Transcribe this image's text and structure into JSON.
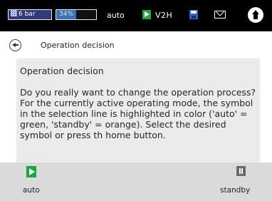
{
  "status_bar": {
    "pressure": "6 bar",
    "soc": "34%",
    "soc_fill_fraction": 0.5,
    "mode": "auto",
    "v2h": "V2H",
    "icons": [
      "play-icon",
      "save-icon",
      "mail-icon",
      "home-icon"
    ],
    "colors": {
      "background": "#000000",
      "play": "#22a83a",
      "save": "#2e66c8"
    }
  },
  "header": {
    "title": "Operation decision",
    "back_icon": "back-arrow-icon"
  },
  "content": {
    "heading": "Operation decision",
    "body": "Do you really want to change the operation process? For the currently active operating mode, the symbol in the selection line is highlighted in color ('auto' = green, 'standby' = orange). Select the desired symbol or press th home button."
  },
  "bottom_bar": {
    "auto": {
      "label": "auto",
      "icon": "play-icon",
      "color": "#18a838"
    },
    "standby": {
      "label": "standby",
      "icon": "pause-icon",
      "color": "#6a6a6a"
    }
  }
}
